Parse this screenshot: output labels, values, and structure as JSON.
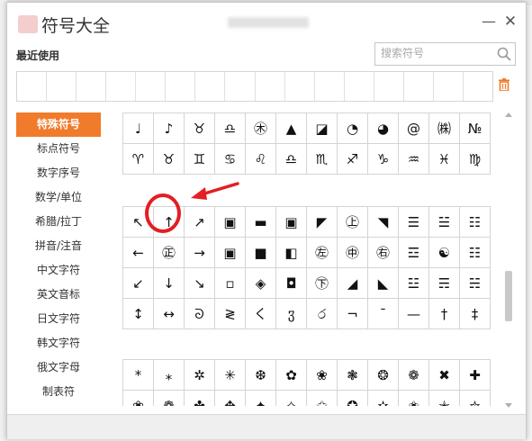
{
  "window": {
    "title": "符号大全",
    "minimize_glyph": "—",
    "close_glyph": "✕"
  },
  "recent": {
    "label": "最近使用",
    "slot_count": 16
  },
  "search": {
    "placeholder": "搜索符号"
  },
  "sidebar": {
    "items": [
      {
        "label": "特殊符号",
        "active": true
      },
      {
        "label": "标点符号"
      },
      {
        "label": "数字序号"
      },
      {
        "label": "数学/单位"
      },
      {
        "label": "希腊/拉丁"
      },
      {
        "label": "拼音/注音"
      },
      {
        "label": "中文字符"
      },
      {
        "label": "英文音标"
      },
      {
        "label": "日文字符"
      },
      {
        "label": "韩文字符"
      },
      {
        "label": "俄文字母"
      },
      {
        "label": "制表符"
      }
    ]
  },
  "symbol_grids": {
    "block1": [
      [
        "♩",
        "♪",
        "♉",
        "♎",
        "㊍",
        "▲",
        "◪",
        "◔",
        "◕",
        "@",
        "㈱",
        "№"
      ],
      [
        "♈",
        "♉",
        "♊",
        "♋",
        "♌",
        "♎",
        "♏",
        "♐",
        "♑",
        "♒",
        "♓",
        "♍"
      ]
    ],
    "block2": [
      [
        "↖",
        "↑",
        "↗",
        "▣",
        "▬",
        "▣",
        "◤",
        "㊤",
        "◥",
        "☰",
        "☱",
        "☷"
      ],
      [
        "←",
        "㊣",
        "→",
        "▣",
        "■",
        "◧",
        "㊧",
        "㊥",
        "㊨",
        "☲",
        "☯",
        "☷"
      ],
      [
        "↙",
        "↓",
        "↘",
        "▫",
        "◈",
        "◘",
        "㊦",
        "◢",
        "◣",
        "☳",
        "☴",
        "☵"
      ],
      [
        "↕",
        "↔",
        "ᘐ",
        "≷",
        "く",
        "ჳ",
        "ර",
        "¬",
        "¯",
        "—",
        "†",
        "‡"
      ]
    ],
    "block3": [
      [
        "*",
        "⁎",
        "✲",
        "✳",
        "❆",
        "✿",
        "❀",
        "❃",
        "❂",
        "❁",
        "✖",
        "✚"
      ],
      [
        "❀",
        "❁",
        "✤",
        "✥",
        "✦",
        "✧",
        "✩",
        "✪",
        "✫",
        "✬",
        "✭",
        "✮"
      ]
    ]
  },
  "colors": {
    "accent": "#f07b2b",
    "annotation_red": "#e31e24"
  }
}
